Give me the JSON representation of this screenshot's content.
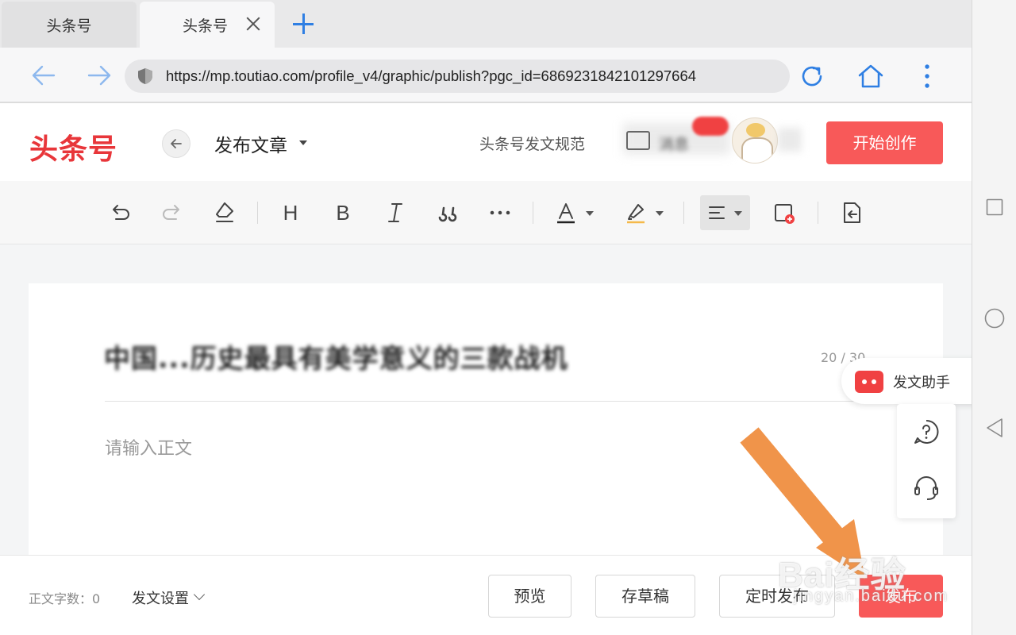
{
  "browser": {
    "tabs": [
      {
        "label": "头条号",
        "active": false
      },
      {
        "label": "头条号",
        "active": true
      }
    ],
    "url": "https://mp.toutiao.com/profile_v4/graphic/publish?pgc_id=6869231842101297664"
  },
  "header": {
    "logo": "头条号",
    "page_title": "发布文章",
    "guide_link": "头条号发文规范",
    "messages_label": "消息",
    "create_button": "开始创作"
  },
  "editor": {
    "title_blurred": "中国...历史最具有美学意义的三款战机",
    "title_count": "20 / 30",
    "body_placeholder": "请输入正文"
  },
  "helpers": {
    "assistant_label": "发文助手"
  },
  "bottom": {
    "wordcount_label": "正文字数：0",
    "settings_label": "发文设置",
    "preview_button": "预览",
    "draft_button": "存草稿",
    "schedule_button": "定时发布",
    "publish_button": "发布"
  },
  "watermark": {
    "brand": "Bai经验",
    "domain": "jingyan.baidu.com"
  },
  "colors": {
    "brand_red": "#e8363a",
    "button_red": "#f85959",
    "link_blue": "#2f7fe3",
    "arrow_orange": "#f0944a"
  },
  "icons": [
    "back-arrow-icon",
    "forward-arrow-icon",
    "shield-icon",
    "reload-icon",
    "home-icon",
    "more-vertical-icon",
    "undo-icon",
    "redo-icon",
    "eraser-icon",
    "heading-icon",
    "bold-icon",
    "italic-icon",
    "quote-icon",
    "more-horizontal-icon",
    "font-color-icon",
    "highlight-icon",
    "align-left-icon",
    "insert-image-icon",
    "import-icon",
    "question-icon",
    "headset-icon",
    "square-icon",
    "circle-icon",
    "triangle-back-icon"
  ]
}
